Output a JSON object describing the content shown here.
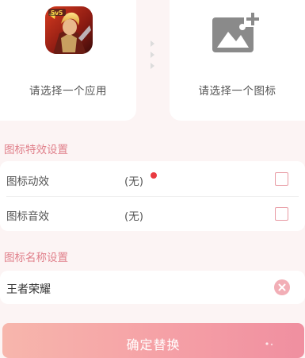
{
  "top": {
    "app_picker_label": "请选择一个应用",
    "icon_picker_label": "请选择一个图标"
  },
  "effects": {
    "title": "图标特效设置",
    "rows": [
      {
        "label": "图标动效",
        "value": "(无)"
      },
      {
        "label": "图标音效",
        "value": "(无)"
      }
    ]
  },
  "name_section": {
    "title": "图标名称设置",
    "value": "王者荣耀"
  },
  "confirm_label": "确定替换",
  "colors": {
    "accent": "#e07f8a",
    "checkbox_border": "#e89aa3",
    "badge_dot": "#e93a40",
    "button_gradient_start": "#f7b6ac",
    "button_gradient_end": "#f08fa0"
  },
  "icons": [
    "app-icon-game",
    "add-image-icon",
    "arrows-right-icon",
    "checkbox-icon",
    "clear-icon"
  ]
}
